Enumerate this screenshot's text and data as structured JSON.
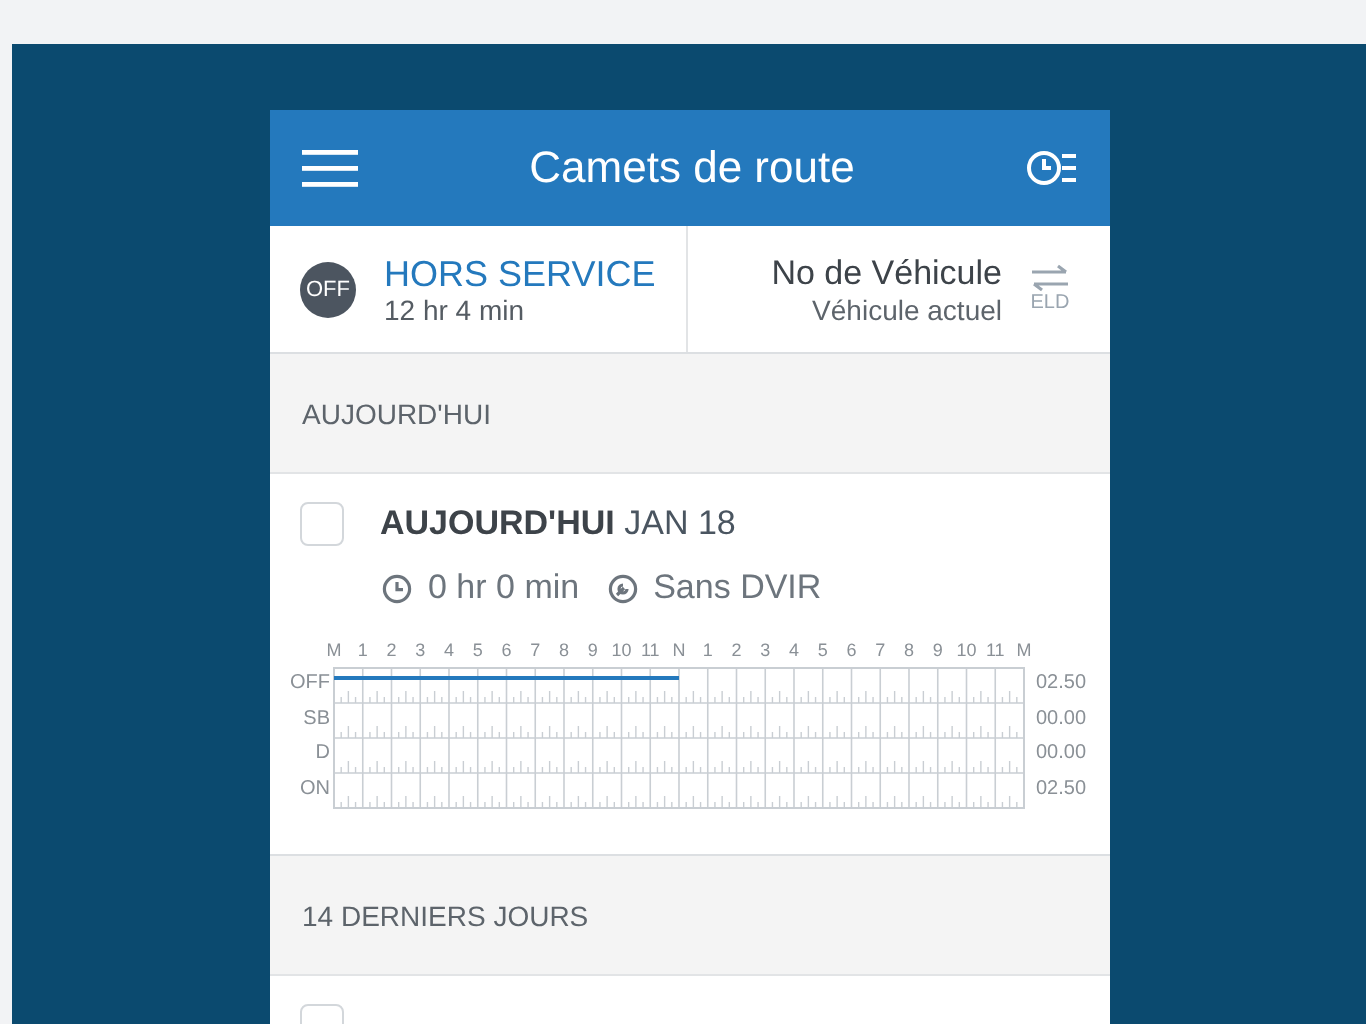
{
  "header": {
    "title": "Camets de route"
  },
  "status": {
    "badge": "OFF",
    "duty": "HORS SERVICE",
    "duration": "12 hr 4 min"
  },
  "vehicle": {
    "title": "No de Véhicule",
    "subtitle": "Véhicule actuel",
    "switch_label": "ELD"
  },
  "sections": [
    {
      "title": "AUJOURD'HUI",
      "days": [
        {
          "checked": false,
          "title": "**AUJOURD'HUI** JAN 18",
          "time": "0 hr 0 min",
          "dvir": "Sans DVIR",
          "graph": {
            "hours": [
              "M",
              "1",
              "2",
              "3",
              "4",
              "5",
              "6",
              "7",
              "8",
              "9",
              "10",
              "11",
              "N",
              "1",
              "2",
              "3",
              "4",
              "5",
              "6",
              "7",
              "8",
              "9",
              "10",
              "11",
              "M"
            ],
            "rows": [
              {
                "label": "OFF",
                "total": "02.50",
                "level": 0.5
              },
              {
                "label": "SB",
                "total": "00.00"
              },
              {
                "label": "D",
                "total": "00.00"
              },
              {
                "label": "ON",
                "total": "02.50"
              }
            ]
          }
        }
      ]
    },
    {
      "title": "14 DERNIERS JOURS",
      "days": [
        {
          "checked": false
        }
      ]
    }
  ]
}
